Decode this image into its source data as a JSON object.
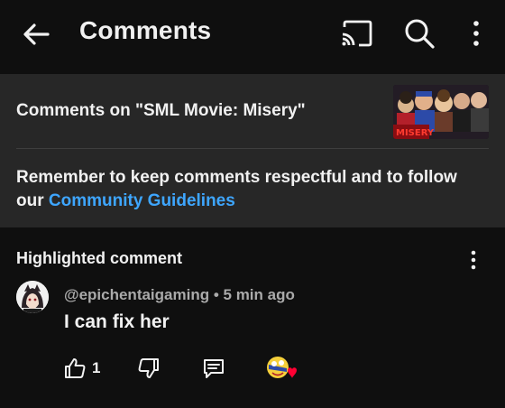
{
  "header": {
    "title": "Comments",
    "icons": [
      "back-arrow-icon",
      "cast-icon",
      "search-icon",
      "more-vert-icon"
    ]
  },
  "video": {
    "comments_on": "Comments on \"SML Movie: Misery\"",
    "thumbnail_caption": "MISERY"
  },
  "notice": {
    "text": "Remember to keep comments respectful and to follow our ",
    "link": "Community Guidelines"
  },
  "highlighted": {
    "label": "Highlighted comment",
    "author": "@epichentaigaming",
    "separator": " • ",
    "time": "5 min ago",
    "text": "I can fix her",
    "like_count": "1"
  },
  "colors": {
    "background": "#0f0f0f",
    "card": "#272727",
    "link": "#3ea6ff",
    "secondary_text": "#aaaaaa",
    "heart": "#ff0033"
  }
}
